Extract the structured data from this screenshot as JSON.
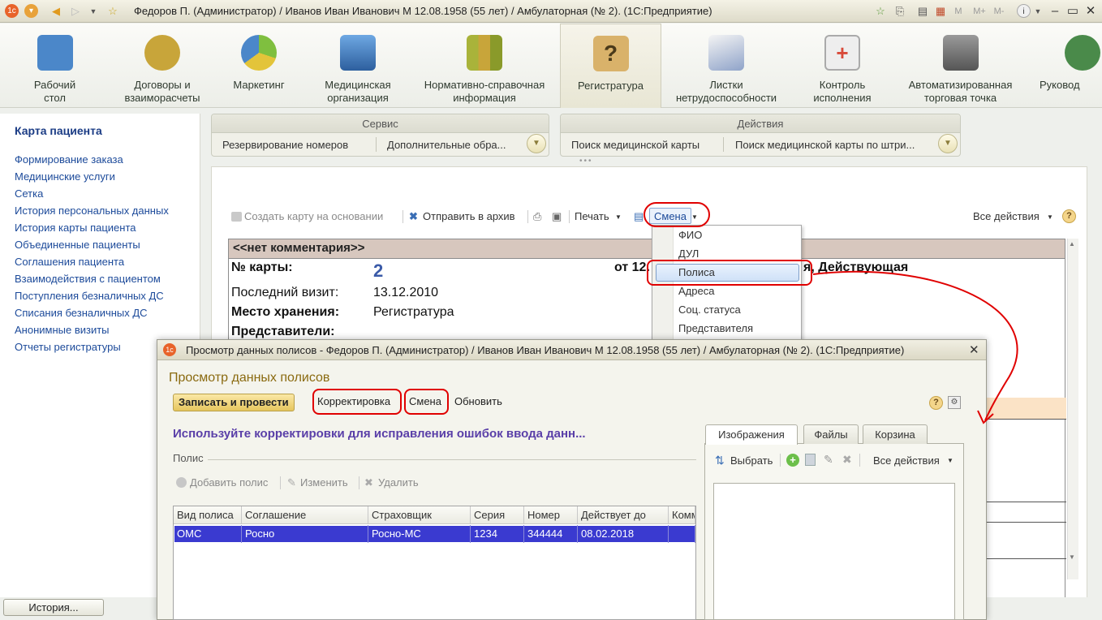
{
  "window": {
    "title": "Федоров П. (Администратор) / Иванов Иван Иванович М 12.08.1958 (55 лет) / Амбулаторная (№ 2).  (1С:Предприятие)",
    "memory_buttons": [
      "M",
      "M+",
      "M-"
    ]
  },
  "sections": [
    {
      "label": "Рабочий\nстол",
      "icon": "desk-icon",
      "color": "#4b87c9"
    },
    {
      "label": "Договоры и\nвзаиморасчеты",
      "icon": "coins-icon",
      "color": "#c8a53a"
    },
    {
      "label": "Маркетинг",
      "icon": "pie-chart-icon",
      "color": "#7fbf3f"
    },
    {
      "label": "Медицинская\nорганизация",
      "icon": "building-icon",
      "color": "#3a7ec9"
    },
    {
      "label": "Нормативно-справочная\nинформация",
      "icon": "binders-icon",
      "color": "#a9b33a"
    },
    {
      "label": "Регистратура",
      "icon": "clipboard-question-icon",
      "color": "#b58a3a"
    },
    {
      "label": "Листки\nнетрудоспособности",
      "icon": "sheets-icon",
      "color": "#8fa3c9"
    },
    {
      "label": "Контроль\nисполнения",
      "icon": "medkit-icon",
      "color": "#d84a3a"
    },
    {
      "label": "Автоматизированная\nторговая точка",
      "icon": "cash-register-icon",
      "color": "#6e6e6e"
    },
    {
      "label": "Руковод",
      "icon": "manager-icon",
      "color": "#4a8a4a"
    }
  ],
  "left_panel": {
    "title": "Карта пациента",
    "items": [
      "Формирование заказа",
      "Медицинские услуги",
      "Сетка",
      "История персональных данных",
      "История карты пациента",
      "Объединенные пациенты",
      "Соглашения пациента",
      "Взаимодействия с пациентом",
      "Поступления безналичных ДС",
      "Списания безналичных ДС",
      "Анонимные визиты",
      "Отчеты регистратуры"
    ]
  },
  "service_panel": {
    "header": "Сервис",
    "items": [
      "Резервирование номеров",
      "Дополнительные обра..."
    ]
  },
  "actions_panel": {
    "header": "Действия",
    "items": [
      "Поиск медицинской карты",
      "Поиск медицинской карты по штри..."
    ]
  },
  "main_toolbar": {
    "create_based": "Создать карту на основании",
    "archive": "Отправить в архив",
    "print": "Печать",
    "change": "Смена",
    "all_actions": "Все действия"
  },
  "card": {
    "comment": "<<нет комментария>>",
    "card_no_label": "№ карты:",
    "card_no": "2",
    "from_prefix": "от 12.",
    "status_suffix": "я, Действующая",
    "last_visit_label": "Последний визит:",
    "last_visit": "13.12.2010",
    "storage_label": "Место хранения:",
    "storage": "Регистратура",
    "reps_label": "Представители:"
  },
  "change_menu": {
    "items": [
      "ФИО",
      "ДУЛ",
      "Полиса",
      "Адреса",
      "Соц. статуса",
      "Представителя"
    ],
    "selected": "Полиса"
  },
  "dialog": {
    "title": "Просмотр данных полисов - Федоров П. (Администратор) / Иванов Иван Иванович М 12.08.1958 (55 лет) / Амбулаторная (№ 2).  (1С:Предприятие)",
    "header": "Просмотр данных полисов",
    "btn_post": "Записать и провести",
    "btn_correction": "Корректировка",
    "btn_change": "Смена",
    "btn_refresh": "Обновить",
    "hint": "Используйте корректировки для исправления ошибок ввода данн...",
    "group_label": "Полис",
    "add": "Добавить полис",
    "edit": "Изменить",
    "delete": "Удалить",
    "columns": [
      "Вид полиса",
      "Соглашение",
      "Страховщик",
      "Серия",
      "Номер",
      "Действует до",
      "Комм"
    ],
    "rows": [
      [
        "ОМС",
        "Росно",
        "Росно-МС",
        "1234",
        "344444",
        "08.02.2018",
        ""
      ]
    ],
    "tabs": [
      "Изображения",
      "Файлы",
      "Корзина"
    ],
    "active_tab": "Изображения",
    "select": "Выбрать",
    "all_actions": "Все действия"
  },
  "bottom": {
    "history": "История..."
  },
  "colors": {
    "link": "#1c4a9a",
    "hint": "#5a3fa8",
    "selection": "#3a3ad0",
    "annotation": "#e00000"
  }
}
